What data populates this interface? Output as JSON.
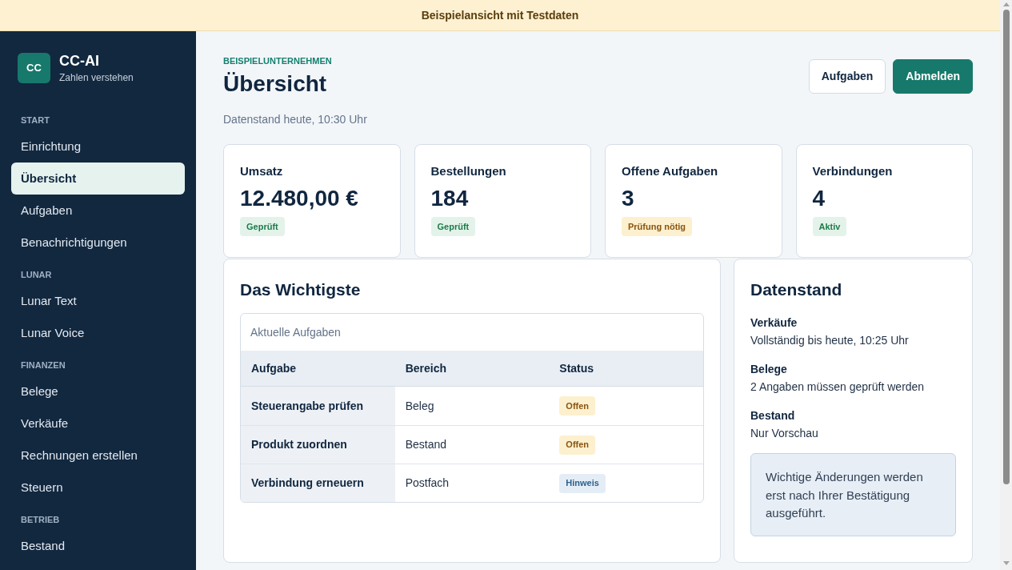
{
  "banner": {
    "text": "Beispielansicht mit Testdaten"
  },
  "sidebar": {
    "logo": {
      "mark": "CC",
      "name": "CC-AI",
      "tagline": "Zahlen verstehen"
    },
    "sections": [
      {
        "heading": "START",
        "items": [
          {
            "label": "Einrichtung",
            "selected": false
          },
          {
            "label": "Übersicht",
            "selected": true
          },
          {
            "label": "Aufgaben",
            "selected": false
          },
          {
            "label": "Benachrichtigungen",
            "selected": false
          }
        ]
      },
      {
        "heading": "LUNAR",
        "items": [
          {
            "label": "Lunar Text",
            "selected": false
          },
          {
            "label": "Lunar Voice",
            "selected": false
          }
        ]
      },
      {
        "heading": "FINANZEN",
        "items": [
          {
            "label": "Belege",
            "selected": false
          },
          {
            "label": "Verkäufe",
            "selected": false
          },
          {
            "label": "Rechnungen erstellen",
            "selected": false
          },
          {
            "label": "Steuern",
            "selected": false
          }
        ]
      },
      {
        "heading": "BETRIEB",
        "items": [
          {
            "label": "Bestand",
            "selected": false
          }
        ]
      }
    ]
  },
  "header": {
    "eyebrow": "BEISPIELUNTERNEHMEN",
    "title": "Übersicht",
    "subtitle": "Datenstand heute, 10:30 Uhr",
    "buttons": [
      {
        "label": "Aufgaben",
        "kind": "secondary"
      },
      {
        "label": "Abmelden",
        "kind": "primary"
      }
    ]
  },
  "stat_cards": [
    {
      "title": "Umsatz",
      "value": "12.480,00 €",
      "badge": {
        "text": "Geprüft",
        "kind": "success"
      }
    },
    {
      "title": "Bestellungen",
      "value": "184",
      "badge": {
        "text": "Geprüft",
        "kind": "success"
      }
    },
    {
      "title": "Offene Aufgaben",
      "value": "3",
      "badge": {
        "text": "Prüfung nötig",
        "kind": "warning"
      }
    },
    {
      "title": "Verbindungen",
      "value": "4",
      "badge": {
        "text": "Aktiv",
        "kind": "success"
      }
    }
  ],
  "important": {
    "title": "Das Wichtigste",
    "table": {
      "caption": "Aktuelle Aufgaben",
      "columns": [
        "Aufgabe",
        "Bereich",
        "Status"
      ],
      "rows": [
        {
          "task": "Steuerangabe prüfen",
          "area": "Beleg",
          "status": {
            "text": "Offen",
            "kind": "warning"
          }
        },
        {
          "task": "Produkt zuordnen",
          "area": "Bestand",
          "status": {
            "text": "Offen",
            "kind": "warning"
          }
        },
        {
          "task": "Verbindung erneuern",
          "area": "Postfach",
          "status": {
            "text": "Hinweis",
            "kind": "info"
          }
        }
      ]
    }
  },
  "data_status": {
    "title": "Datenstand",
    "items": [
      {
        "label": "Verkäufe",
        "value": "Vollständig bis heute, 10:25 Uhr"
      },
      {
        "label": "Belege",
        "value": "2 Angaben müssen geprüft werden"
      },
      {
        "label": "Bestand",
        "value": "Nur Vorschau"
      }
    ],
    "notice": "Wichtige Änderungen werden erst nach Ihrer Bestätigung ausgeführt."
  }
}
